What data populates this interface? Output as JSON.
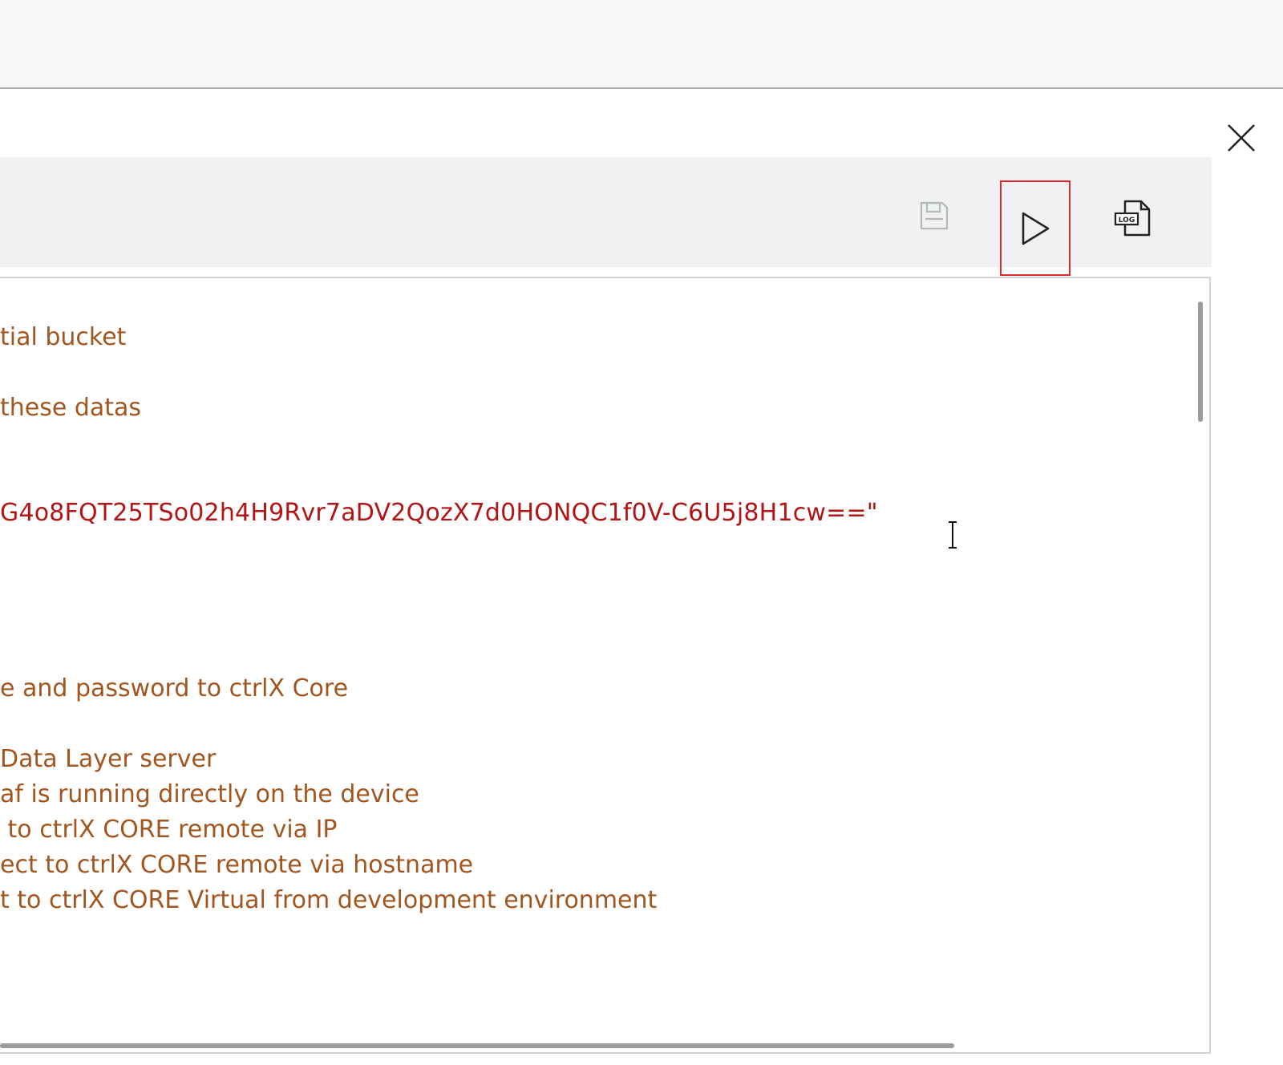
{
  "icons": {
    "close": "close-icon",
    "save": "save-icon",
    "run": "play-icon",
    "log": "log-file-icon",
    "text_cursor": "text-cursor-icon"
  },
  "toolbar": {
    "log_label": "LOG"
  },
  "colors": {
    "comment": "#a3551e",
    "string": "#b11515",
    "toolbar_bg": "#eff1f2",
    "highlight": "#e2272c"
  },
  "editor": {
    "lines": [
      "tial bucket",
      "these datas",
      "G4o8FQT25TSo02h4H9Rvr7aDV2QozX7d0HONQC1f0V-C6U5j8H1cw==\"",
      "e and password to ctrlX Core",
      "Data Layer server",
      "af is running directly on the device",
      " to ctrlX CORE remote via IP",
      "ect to ctrlX CORE remote via hostname",
      "t to ctrlX CORE Virtual from development environment"
    ]
  }
}
